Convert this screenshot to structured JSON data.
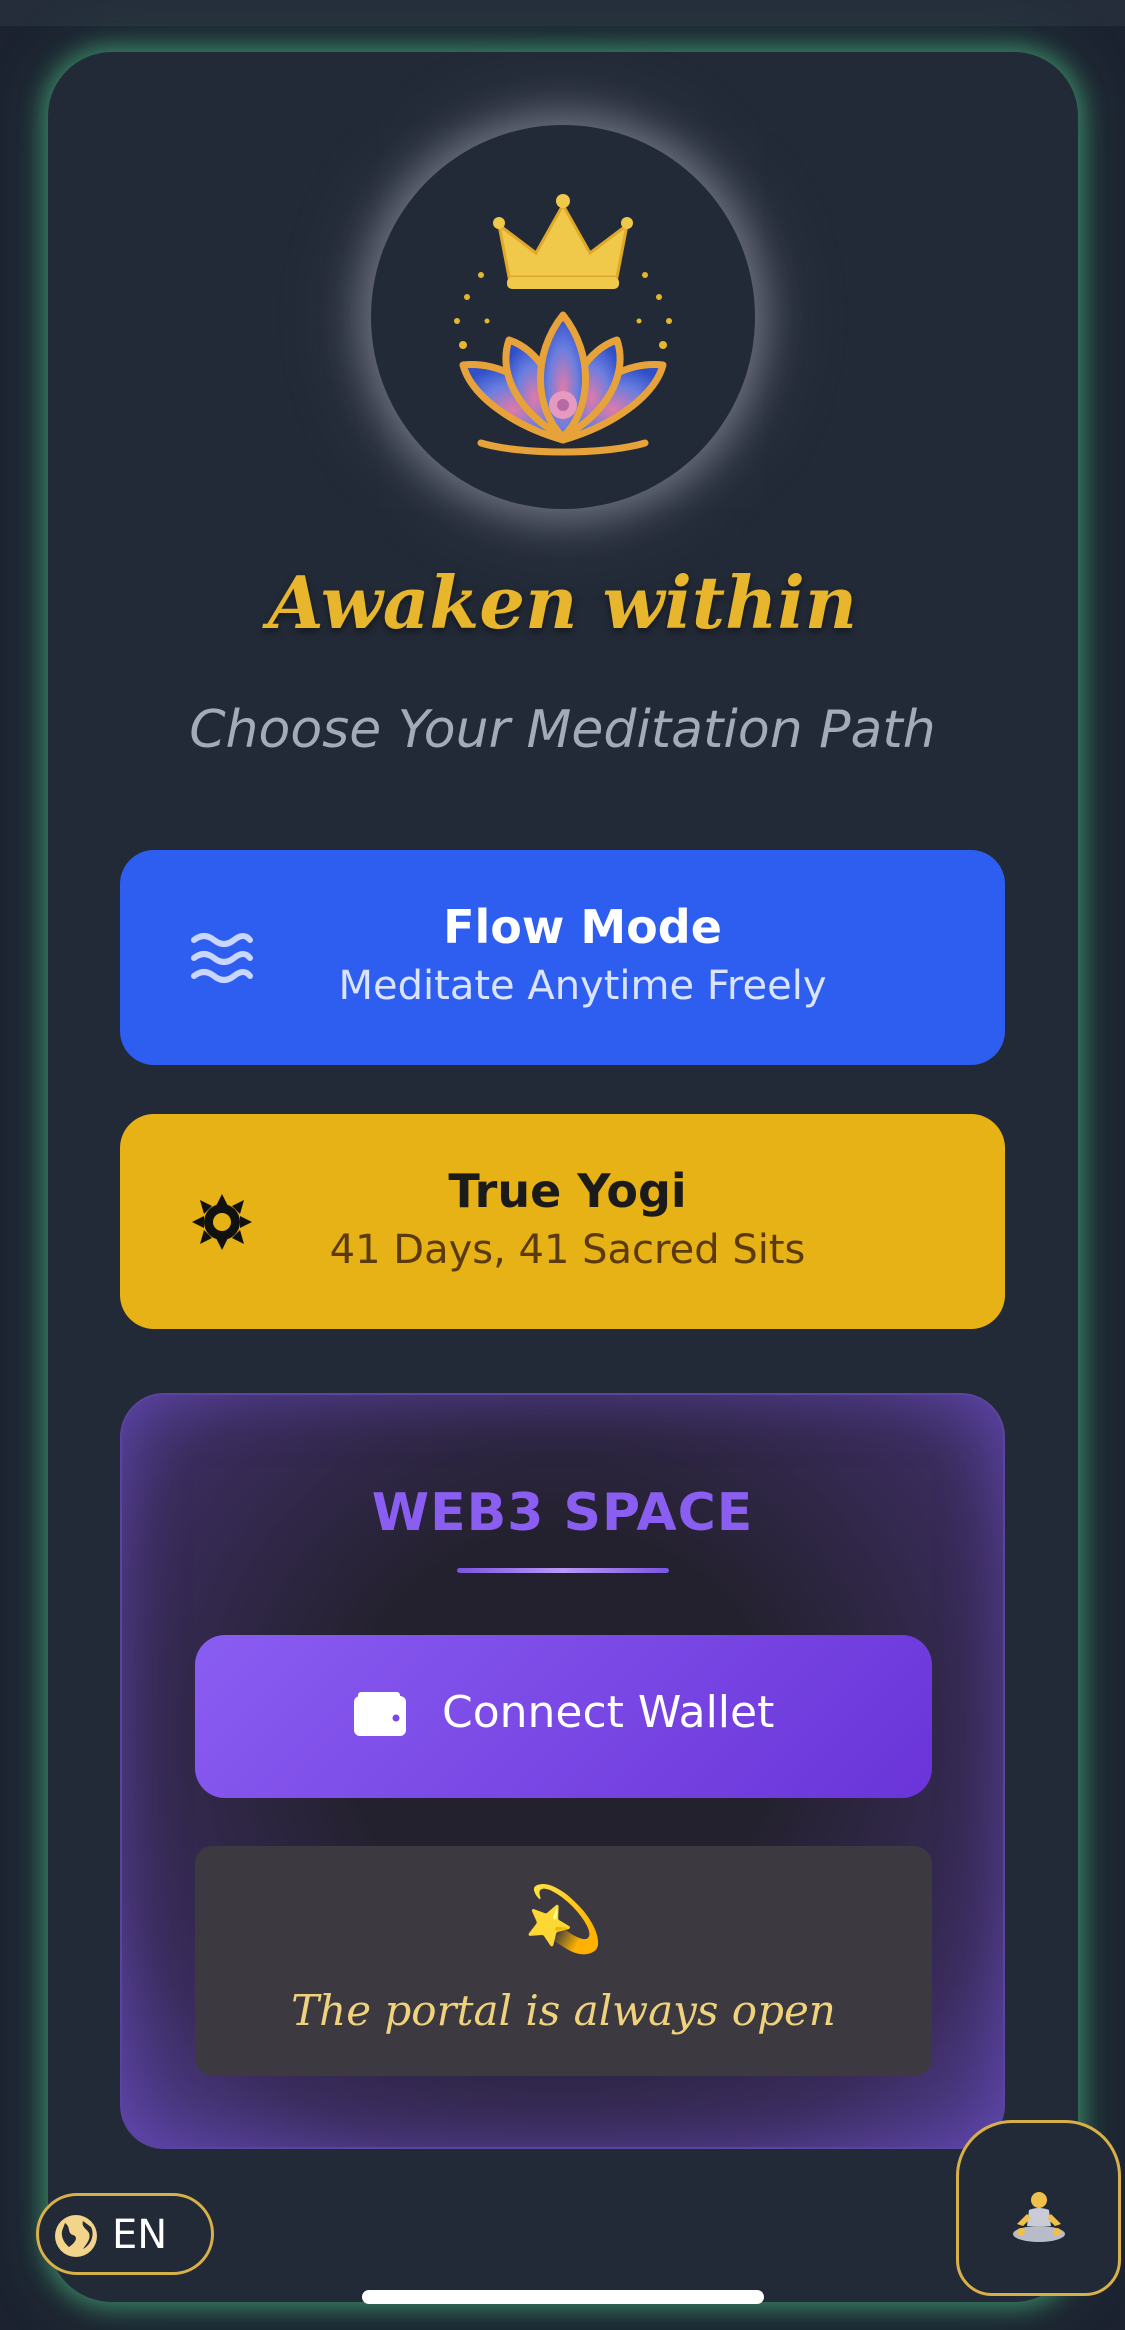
{
  "header": {
    "title": "Awaken within",
    "subtitle": "Choose Your Meditation Path"
  },
  "logo": {
    "icon": "lotus-crown-icon",
    "colors": {
      "gold": "#e8b62d",
      "lotus_blue": "#4a6ad8",
      "lotus_pink": "#e07aa8"
    }
  },
  "modes": {
    "flow": {
      "label": "Flow Mode",
      "description": "Meditate Anytime Freely",
      "icon": "waves-icon",
      "color": "#2d5ef0"
    },
    "yogi": {
      "label": "True Yogi",
      "description": "41 Days, 41 Sacred Sits",
      "icon": "sun-icon",
      "color": "#e6b216"
    }
  },
  "web3": {
    "title": "WEB3 SPACE",
    "connect_label": "Connect Wallet",
    "wallet_icon": "wallet-icon",
    "portal_glyph": "💫",
    "portal_text": "The portal is always open",
    "accent": "#8a5ef0"
  },
  "footer": {
    "language": "EN",
    "language_icon": "globe-icon",
    "meditate_icon": "meditating-person-icon",
    "border_color": "#d8b048"
  },
  "theme": {
    "background": "#1c2230",
    "card": "#232a37",
    "glow": "#4abe82"
  }
}
